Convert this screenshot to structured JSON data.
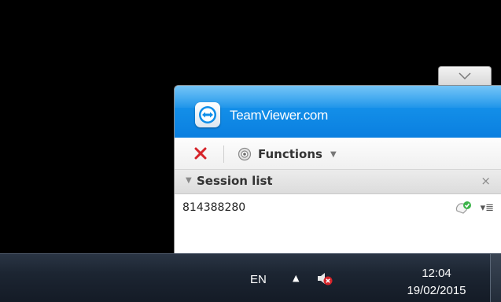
{
  "collapse_tab": {
    "icon": "chevron-down-icon"
  },
  "header": {
    "brand": "TeamViewer.com",
    "logo_icon": "teamviewer-logo-icon"
  },
  "toolbar": {
    "close_icon": "close-icon",
    "functions_label": "Functions",
    "functions_icon": "webcam-icon"
  },
  "session_list": {
    "title": "Session list",
    "close_glyph": "×",
    "collapse_icon": "triangle-down-icon"
  },
  "sessions": [
    {
      "id": "814388280",
      "status_icon": "connected-check-icon",
      "menu_icon": "menu-icon"
    }
  ],
  "taskbar": {
    "language": "EN",
    "time": "12:04",
    "date": "19/02/2015",
    "tray_icon": "triangle-up-icon",
    "volume_icon": "speaker-muted-icon"
  },
  "colors": {
    "header_blue": "#138ee8",
    "close_red": "#d6242a",
    "taskbar": "#1c2532"
  }
}
